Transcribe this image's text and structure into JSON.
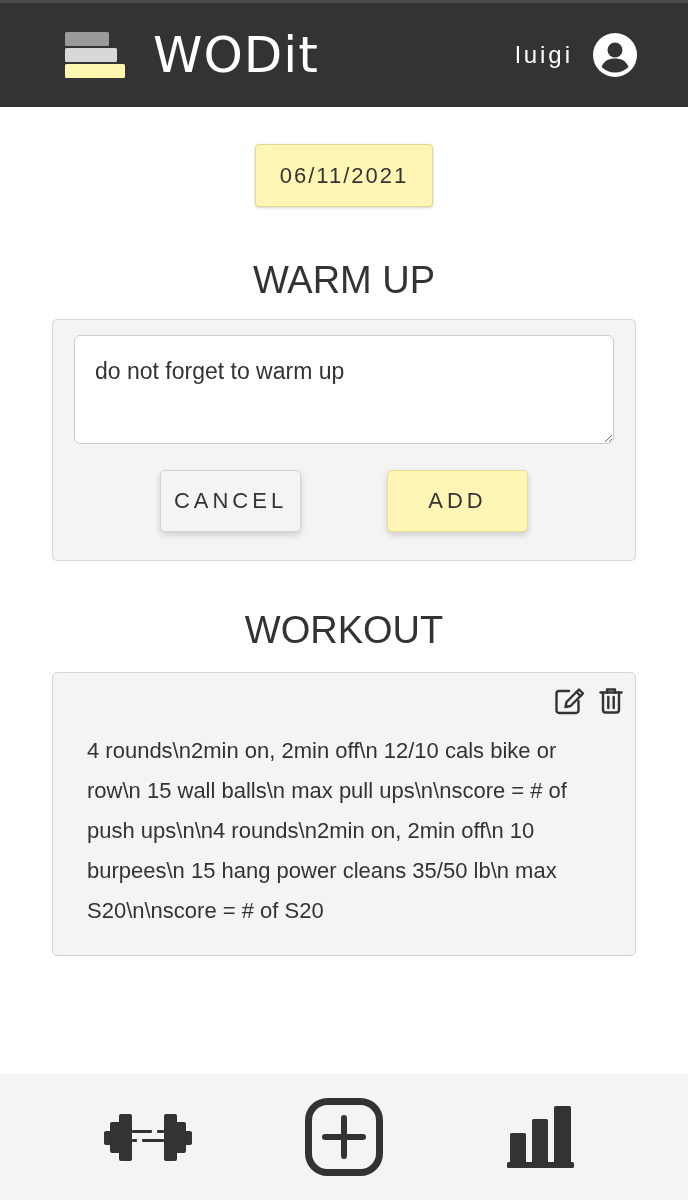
{
  "header": {
    "brand": "WODit",
    "username": "luigi"
  },
  "date": {
    "label": "06/11/2021"
  },
  "warm_up": {
    "title": "WARM UP",
    "input": {
      "value": "do not forget to warm up"
    },
    "buttons": [
      {
        "label": "CANCEL",
        "kind": "secondary"
      },
      {
        "label": "ADD",
        "kind": "primary"
      }
    ]
  },
  "workout": {
    "title": "WORKOUT",
    "text": "4 rounds\\n2min on, 2min off\\n 12/10 cals bike or row\\n 15 wall balls\\n max pull ups\\n\\nscore = # of push ups\\n\\n4 rounds\\n2min on, 2min off\\n 10 burpees\\n 15 hang power cleans 35/50 lb\\n max S20\\n\\nscore = # of S20"
  }
}
